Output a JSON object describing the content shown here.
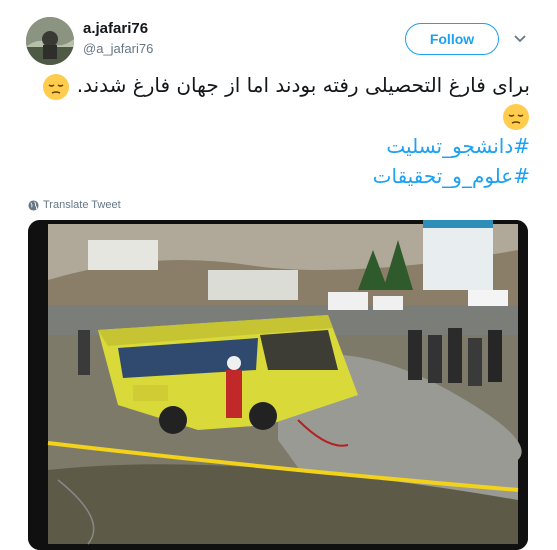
{
  "user": {
    "name": "a.jafari76",
    "handle": "@a_jafari76"
  },
  "follow_label": "Follow",
  "tweet": {
    "text": "برای فارغ التحصیلی رفته بودند اما از جهان فارغ شدند.",
    "hashtags": [
      "#دانشجو_تسلیت",
      "#علوم_و_تحقیقات"
    ]
  },
  "translate_label": "Translate Tweet",
  "colors": {
    "accent": "#1da1f2",
    "secondary_text": "#657786"
  },
  "icons": {
    "menu": "chevron-down-icon",
    "emoji": "pensive-face-icon",
    "translate": "globe-icon"
  }
}
